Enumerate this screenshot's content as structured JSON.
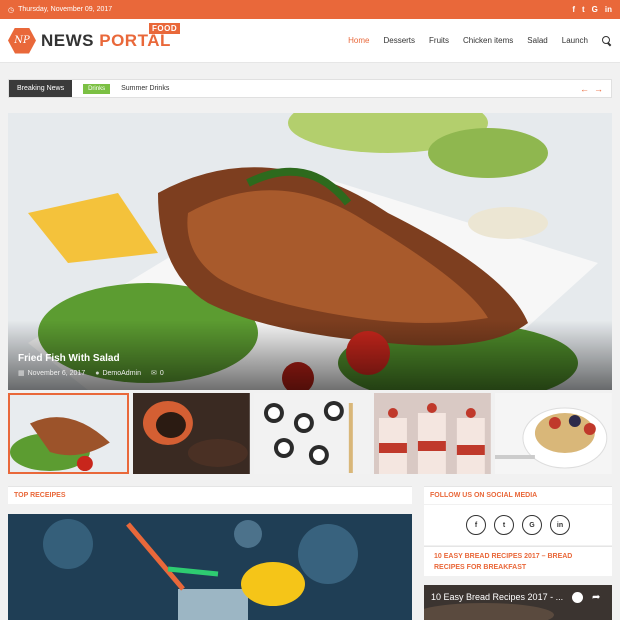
{
  "topbar": {
    "date": "Thursday, November 09, 2017",
    "social_icons": [
      "f",
      "t",
      "G",
      "in"
    ]
  },
  "header": {
    "logo_initials": "NP",
    "logo_word1": "NEWS",
    "logo_word2": "PORTAL",
    "logo_tag": "FOOD",
    "nav": [
      "Home",
      "Desserts",
      "Fruits",
      "Chicken items",
      "Salad",
      "Launch"
    ]
  },
  "breaking": {
    "label": "Breaking News",
    "tag": "Drinks",
    "title": "Summer Drinks"
  },
  "hero": {
    "title": "Fried Fish With Salad",
    "date": "November 6, 2017",
    "author": "DemoAdmin",
    "comments": "0"
  },
  "sections": {
    "top_recipes": "TOP RECEIPES",
    "follow": "FOLLOW US ON SOCIAL MEDIA",
    "side_title": "10 EASY BREAD RECIPES 2017 – BREAD RECIPES FOR BREAKFAST"
  },
  "follow_icons": [
    "f",
    "t",
    "G",
    "in"
  ],
  "video": {
    "title": "10 Easy Bread Recipes 2017 - ..."
  },
  "colors": {
    "accent": "#e9683a",
    "breaking_label": "#3a3a3a",
    "tag": "#7bc043"
  }
}
